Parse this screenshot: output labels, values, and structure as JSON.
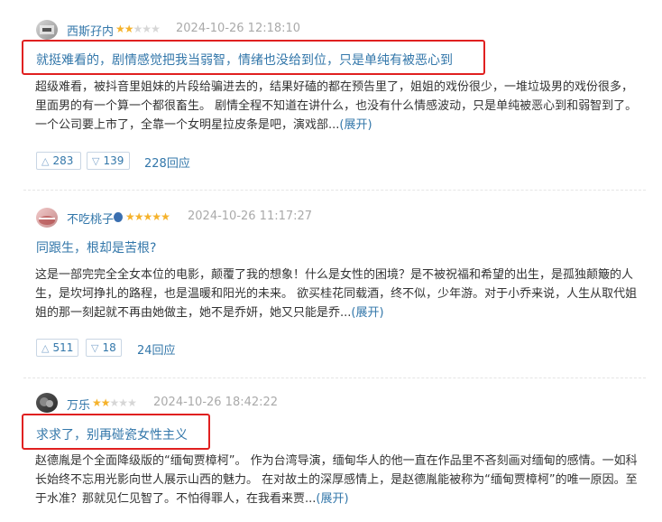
{
  "reviews": [
    {
      "author": "西斯孖内",
      "rating": 2,
      "time": "2024-10-26 12:18:10",
      "title": "就挺难看的，剧情感觉把我当弱智，情绪也没给到位，只是单纯有被恶心到",
      "body": [
        "超级难看，被抖音里姐妹的片段给骗进去的，结果好磕的都在预告里了，姐姐的戏份很少，一堆垃圾男的戏份很多，",
        "里面男的有一个算一个都很畜生。 剧情全程不知道在讲什么，也没有什么情感波动，只是单纯被恶心到和弱智到了。",
        "一个公司要上市了，全靠一个女明星拉皮条是吧，演戏部..."
      ],
      "expand": "(展开)",
      "up": "283",
      "down": "139",
      "replies": "228回应"
    },
    {
      "author": "不吃桃子",
      "rating": 5,
      "time": "2024-10-26 11:17:27",
      "title": "同跟生，根却是苦根?",
      "body": [
        "这是一部完完全全女本位的电影，颠覆了我的想象！什么是女性的困境？是不被祝福和希望的出生，是孤独颠簸的人",
        "生，是坎坷挣扎的路程，也是温暖和阳光的未来。 欲买桂花同载酒，终不似，少年游。对于小乔来说，人生从取代姐",
        "姐的那一刻起就不再由她做主，她不是乔妍，她又只能是乔..."
      ],
      "expand": "(展开)",
      "up": "511",
      "down": "18",
      "replies": "24回应"
    },
    {
      "author": "万乐",
      "rating": 2,
      "time": "2024-10-26 18:42:22",
      "title": "求求了，别再碰瓷女性主义",
      "body": [
        "赵德胤是个全面降级版的“缅甸贾樟柯”。 作为台湾导演，缅甸华人的他一直在作品里不吝刻画对缅甸的感情。一如科",
        "长始终不忘用光影向世人展示山西的魅力。 在对故土的深厚感情上，是赵德胤能被称为“缅甸贾樟柯”的唯一原因。至",
        "于水准？那就见仁见智了。不怕得罪人，在我看来贾..."
      ],
      "expand": "(展开)"
    }
  ],
  "colors": {
    "link": "#3377aa",
    "star": "#f5b22b",
    "highlight": "#e02020"
  },
  "icons": {
    "up": "triangle-up-icon",
    "down": "triangle-down-icon"
  }
}
